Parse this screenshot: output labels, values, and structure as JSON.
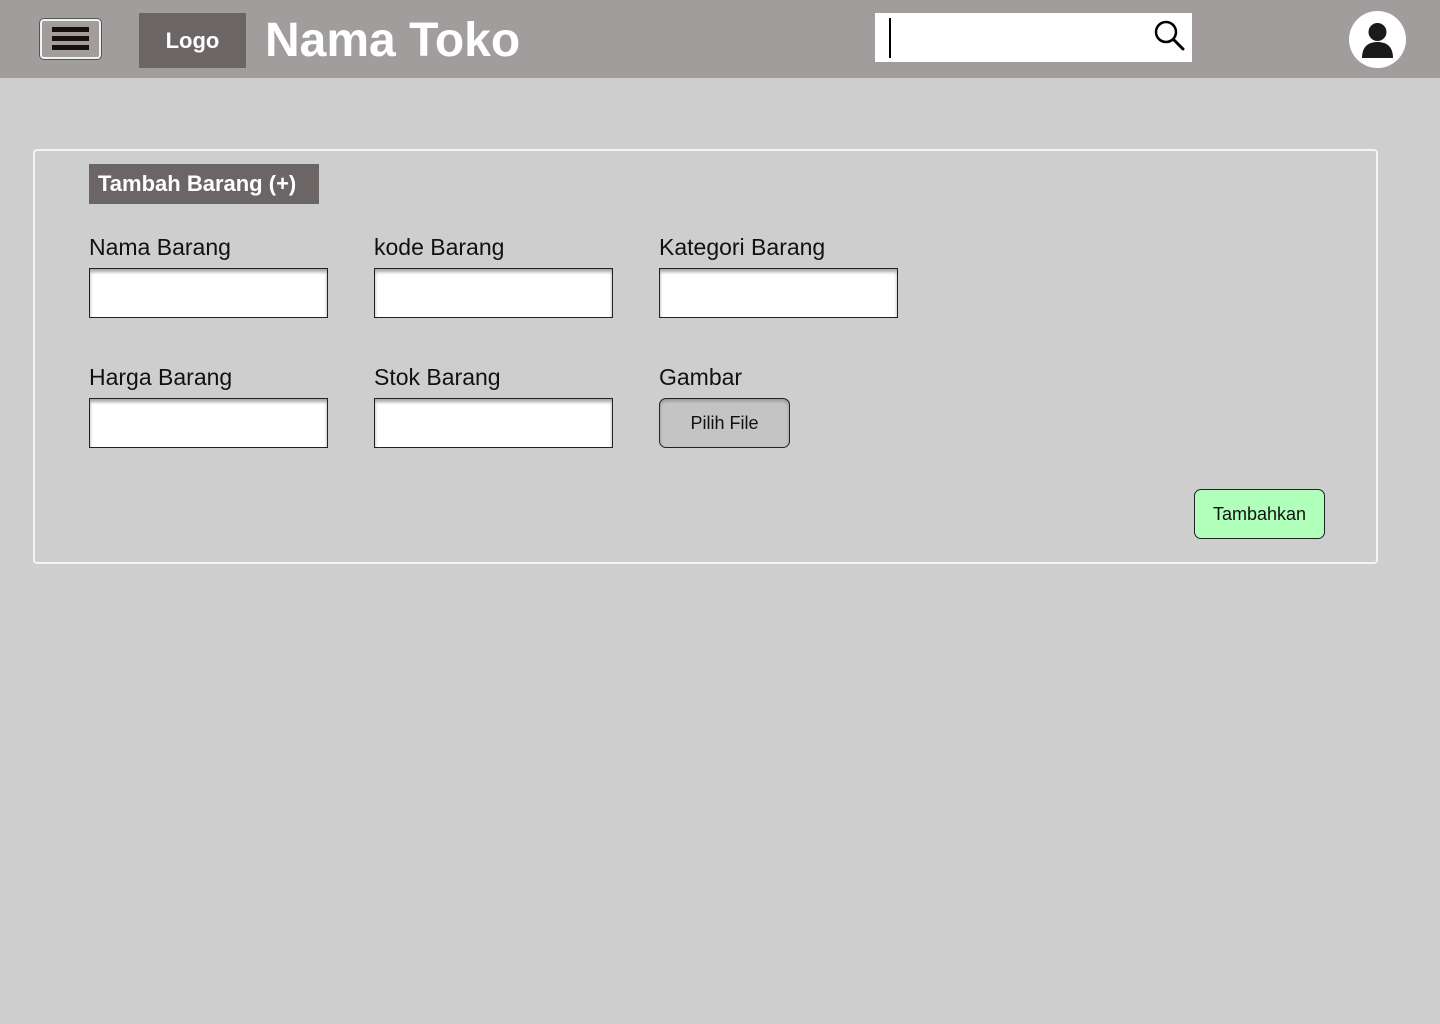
{
  "header": {
    "logo_text": "Logo",
    "store_name": "Nama Toko",
    "search": {
      "value": "",
      "placeholder": ""
    }
  },
  "form": {
    "title": "Tambah Barang (+)",
    "fields": {
      "nama_barang": {
        "label": "Nama Barang",
        "value": ""
      },
      "kode_barang": {
        "label": "kode Barang",
        "value": ""
      },
      "kategori_barang": {
        "label": "Kategori Barang",
        "value": ""
      },
      "harga_barang": {
        "label": "Harga Barang",
        "value": ""
      },
      "stok_barang": {
        "label": "Stok Barang",
        "value": ""
      }
    },
    "gambar": {
      "label": "Gambar",
      "button_label": "Pilih File"
    },
    "submit_label": "Tambahkan"
  },
  "icons": {
    "menu": "hamburger-menu-icon",
    "search": "search-icon",
    "user": "user-icon"
  },
  "colors": {
    "header_bg": "#a29d9d",
    "page_bg": "#cecece",
    "logo_bg": "#6b6565",
    "submit_bg": "#b0ffbb",
    "file_button_bg": "#c4c4c4"
  }
}
